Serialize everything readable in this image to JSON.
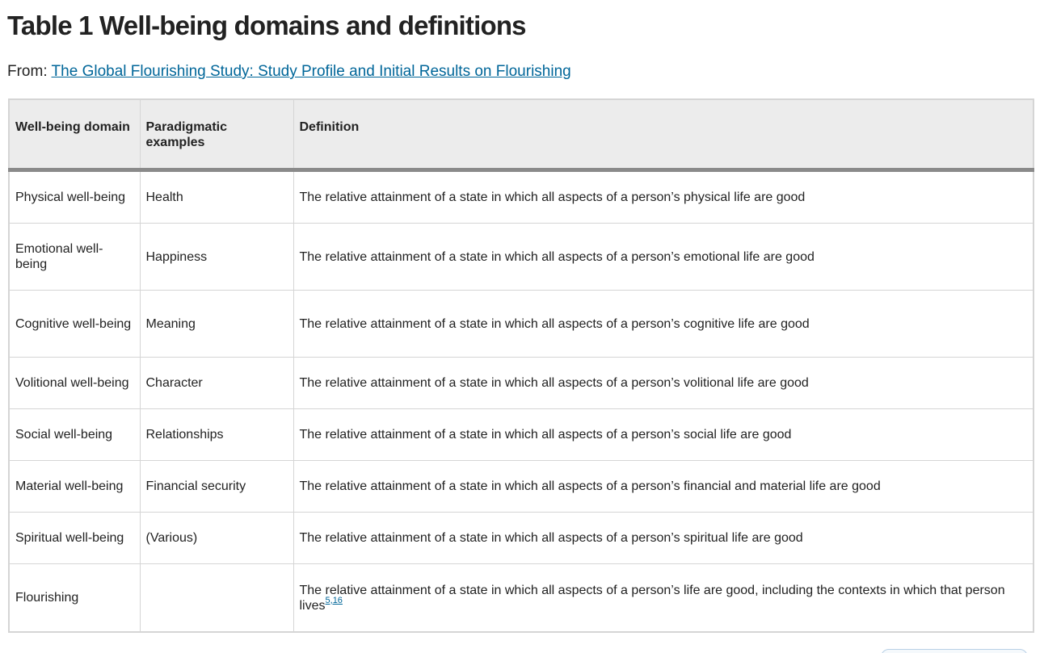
{
  "title": "Table 1 Well-being domains and definitions",
  "source": {
    "prefix": "From:",
    "link_text": "The Global Flourishing Study: Study Profile and Initial Results on Flourishing"
  },
  "table": {
    "headers": {
      "domain": "Well-being domain",
      "examples": "Paradigmatic examples",
      "definition": "Definition"
    },
    "rows": [
      {
        "domain": "Physical well-being",
        "examples": "Health",
        "definition": "The relative attainment of a state in which all aspects of a person’s physical life are good"
      },
      {
        "domain": "Emotional well-being",
        "examples": "Happiness",
        "definition": "The relative attainment of a state in which all aspects of a person’s emotional life are good"
      },
      {
        "domain": "Cognitive well-being",
        "examples": "Meaning",
        "definition": "The relative attainment of a state in which all aspects of a person’s cognitive life are good"
      },
      {
        "domain": "Volitional well-being",
        "examples": "Character",
        "definition": "The relative attainment of a state in which all aspects of a person’s volitional life are good"
      },
      {
        "domain": "Social well-being",
        "examples": "Relationships",
        "definition": "The relative attainment of a state in which all aspects of a person’s social life are good"
      },
      {
        "domain": "Material well-being",
        "examples": "Financial security",
        "definition": "The relative attainment of a state in which all aspects of a person’s financial and material life are good"
      },
      {
        "domain": "Spiritual well-being",
        "examples": "(Various)",
        "definition": "The relative attainment of a state in which all aspects of a person’s spiritual life are good"
      },
      {
        "domain": "Flourishing",
        "examples": "",
        "definition": "The relative attainment of a state in which all aspects of a person’s life are good, including the contexts in which that person lives",
        "refs": "5,16"
      }
    ]
  },
  "colors": {
    "link": "#006699",
    "header_bg": "#ececec",
    "header_rule": "#8a8a8a",
    "border": "#d5d5d5"
  }
}
